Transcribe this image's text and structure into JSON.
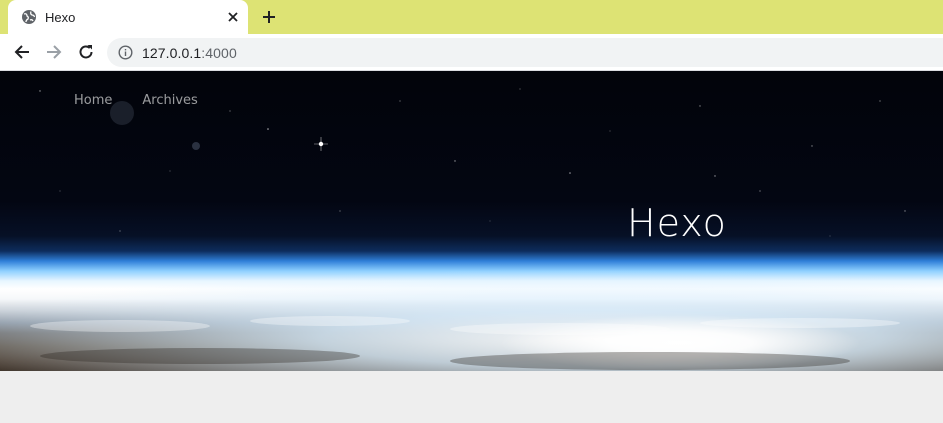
{
  "browser": {
    "tab": {
      "title": "Hexo",
      "favicon": "globe-icon",
      "close_icon": "close-icon"
    },
    "new_tab_icon": "plus-icon",
    "toolbar": {
      "back_icon": "arrow-left-icon",
      "forward_icon": "arrow-right-icon",
      "reload_icon": "reload-icon",
      "site_info_icon": "info-icon",
      "url_host": "127.0.0.1",
      "url_port": ":4000"
    },
    "colors": {
      "tabstrip": "#dde374",
      "toolbar": "#ffffff",
      "omnibox": "#f1f3f4"
    }
  },
  "page": {
    "nav": [
      {
        "label": "Home"
      },
      {
        "label": "Archives"
      }
    ],
    "site_title": "Hexo",
    "banner": "earth-horizon-space-image",
    "background_color": "#eeeeee"
  }
}
